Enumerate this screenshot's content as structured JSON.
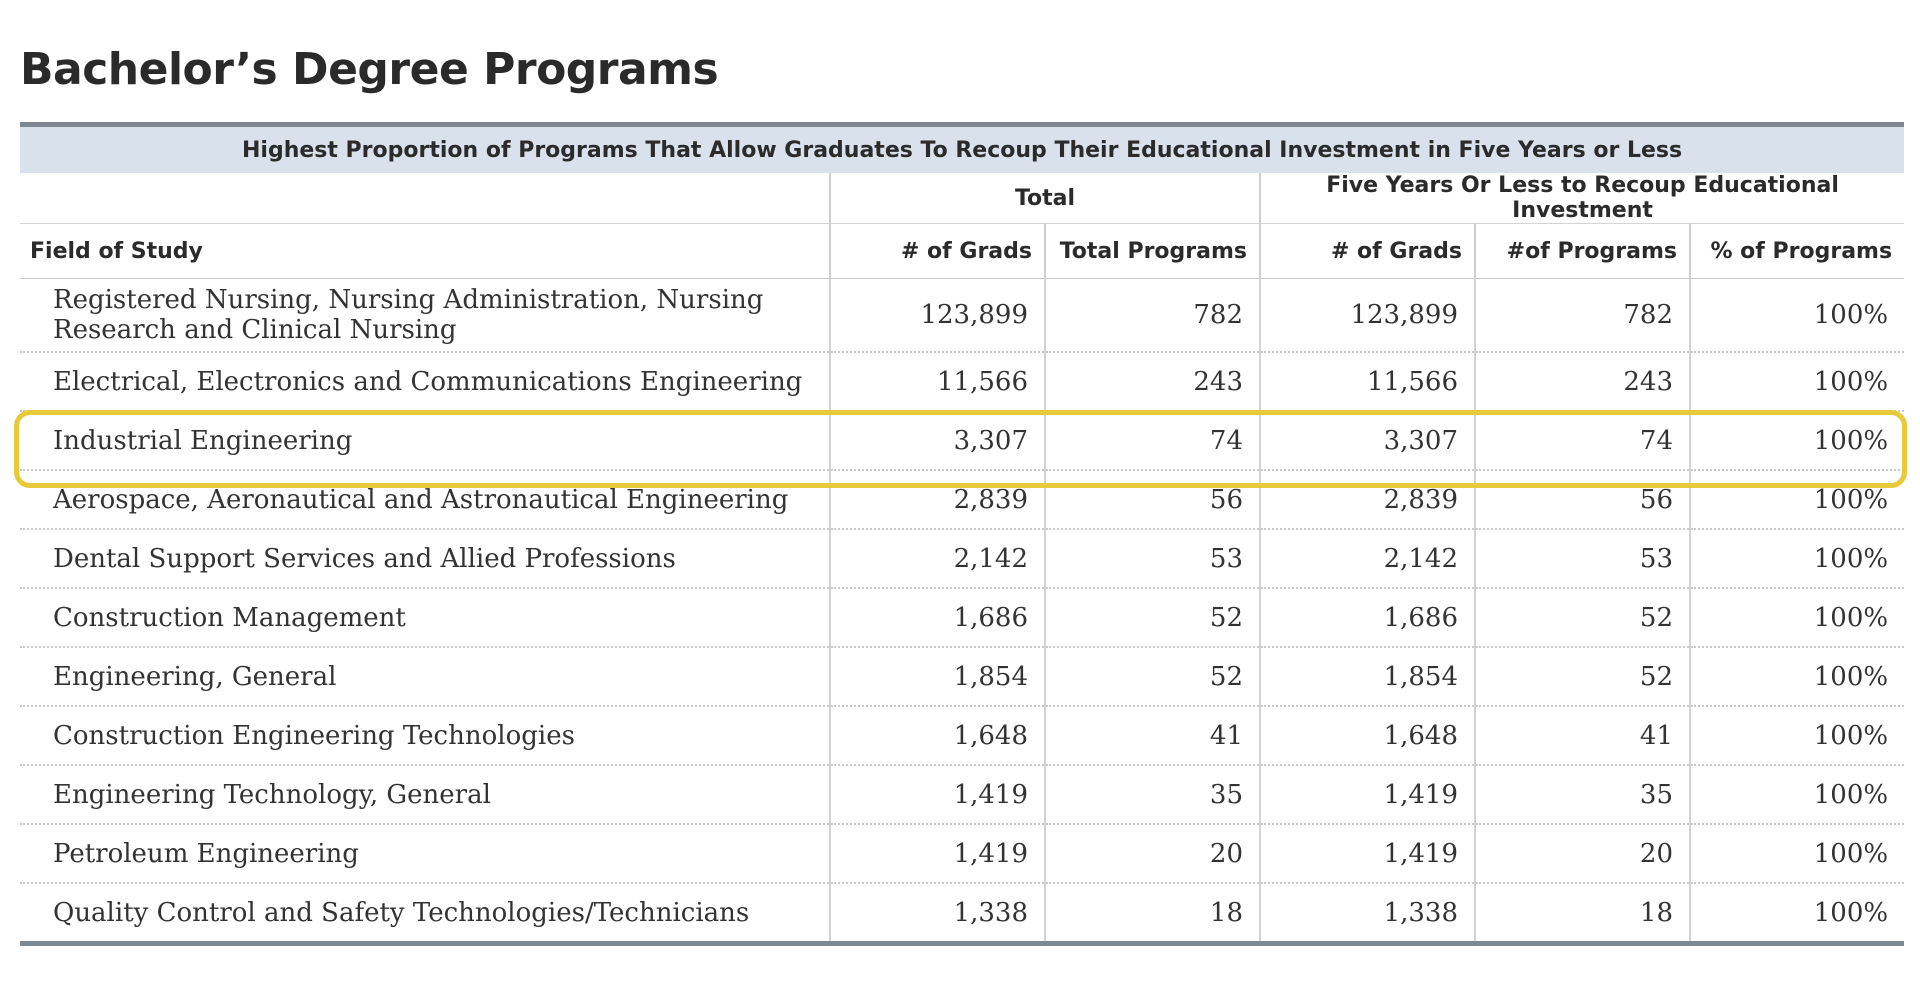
{
  "page": {
    "title": "Bachelor’s Degree Programs"
  },
  "table": {
    "caption": "Highest Proportion of Programs That Allow Graduates To Recoup Their Educational Investment in Five Years or Less",
    "groups": {
      "total": "Total",
      "five_years": "Five Years Or Less to Recoup Educational Investment"
    },
    "columns": {
      "field": "Field of Study",
      "total_grads": "# of Grads",
      "total_programs": "Total Programs",
      "five_grads": "# of Grads",
      "five_programs": "#of Programs",
      "pct_programs": "% of Programs"
    },
    "rows": [
      {
        "field": "Registered Nursing, Nursing Administration, Nursing Research and Clinical Nursing",
        "total_grads": "123,899",
        "total_programs": "782",
        "five_grads": "123,899",
        "five_programs": "782",
        "pct": "100%"
      },
      {
        "field": "Electrical, Electronics and Communications Engineering",
        "total_grads": "11,566",
        "total_programs": "243",
        "five_grads": "11,566",
        "five_programs": "243",
        "pct": "100%"
      },
      {
        "field": "Industrial Engineering",
        "total_grads": "3,307",
        "total_programs": "74",
        "five_grads": "3,307",
        "five_programs": "74",
        "pct": "100%"
      },
      {
        "field": "Aerospace, Aeronautical and Astronautical Engineering",
        "total_grads": "2,839",
        "total_programs": "56",
        "five_grads": "2,839",
        "five_programs": "56",
        "pct": "100%"
      },
      {
        "field": "Dental Support Services and Allied Professions",
        "total_grads": "2,142",
        "total_programs": "53",
        "five_grads": "2,142",
        "five_programs": "53",
        "pct": "100%"
      },
      {
        "field": "Construction Management",
        "total_grads": "1,686",
        "total_programs": "52",
        "five_grads": "1,686",
        "five_programs": "52",
        "pct": "100%"
      },
      {
        "field": "Engineering, General",
        "total_grads": "1,854",
        "total_programs": "52",
        "five_grads": "1,854",
        "five_programs": "52",
        "pct": "100%"
      },
      {
        "field": "Construction Engineering Technologies",
        "total_grads": "1,648",
        "total_programs": "41",
        "five_grads": "1,648",
        "five_programs": "41",
        "pct": "100%"
      },
      {
        "field": "Engineering Technology, General",
        "total_grads": "1,419",
        "total_programs": "35",
        "five_grads": "1,419",
        "five_programs": "35",
        "pct": "100%"
      },
      {
        "field": "Petroleum Engineering",
        "total_grads": "1,419",
        "total_programs": "20",
        "five_grads": "1,419",
        "five_programs": "20",
        "pct": "100%"
      },
      {
        "field": "Quality Control and Safety Technologies/Technicians",
        "total_grads": "1,338",
        "total_programs": "18",
        "five_grads": "1,338",
        "five_programs": "18",
        "pct": "100%"
      }
    ]
  },
  "colors": {
    "caption_band": "#d9e2ec",
    "rule": "#7d8893",
    "highlight": "#e8c93a"
  }
}
